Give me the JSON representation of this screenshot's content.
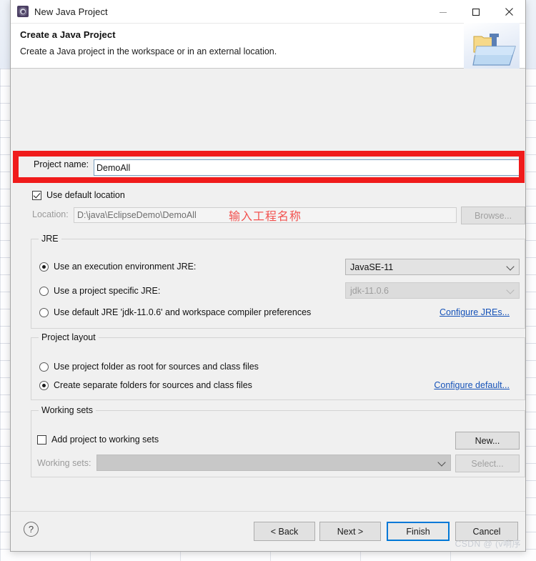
{
  "window": {
    "title": "New Java Project",
    "icon": "eclipse-wizard-icon",
    "minimize_label": "Minimize",
    "maximize_label": "Maximize",
    "close_label": "Close"
  },
  "header": {
    "title": "Create a Java Project",
    "subtitle": "Create a Java project in the workspace or in an external location.",
    "art_icon": "java-project-folder-icon"
  },
  "project": {
    "name_label": "Project name:",
    "name_value": "DemoAll",
    "name_placeholder": "",
    "use_default_location_label": "Use default location",
    "use_default_location_checked": true,
    "location_label": "Location:",
    "location_value": "D:\\java\\EclipseDemo\\DemoAll",
    "browse_label": "Browse..."
  },
  "annotation": {
    "text": "输入工程名称",
    "color": "#f2524f",
    "highlight_color": "#f01b1b"
  },
  "jre": {
    "group_title": "JRE",
    "options": [
      {
        "label": "Use an execution environment JRE:",
        "selected": true
      },
      {
        "label": "Use a project specific JRE:",
        "selected": false
      },
      {
        "label": "Use default JRE 'jdk-11.0.6' and workspace compiler preferences",
        "selected": false
      }
    ],
    "execution_env_value": "JavaSE-11",
    "project_jre_value": "jdk-11.0.6",
    "configure_link": "Configure JREs..."
  },
  "project_layout": {
    "group_title": "Project layout",
    "options": [
      {
        "label": "Use project folder as root for sources and class files",
        "selected": false
      },
      {
        "label": "Create separate folders for sources and class files",
        "selected": true
      }
    ],
    "configure_link": "Configure default..."
  },
  "working_sets": {
    "group_title": "Working sets",
    "add_label": "Add project to working sets",
    "add_checked": false,
    "sets_label": "Working sets:",
    "sets_value": "",
    "new_label": "New...",
    "select_label": "Select..."
  },
  "footer": {
    "help_label": "?",
    "back_label": "< Back",
    "next_label": "Next >",
    "finish_label": "Finish",
    "cancel_label": "Cancel",
    "default_button": "Finish"
  },
  "watermark": {
    "text": "CSDN @ (v响序"
  },
  "colors": {
    "accent": "#0078d7",
    "link": "#1552b8",
    "dialog_bg": "#f0f0f0",
    "annotation_red": "#f01b1b"
  }
}
